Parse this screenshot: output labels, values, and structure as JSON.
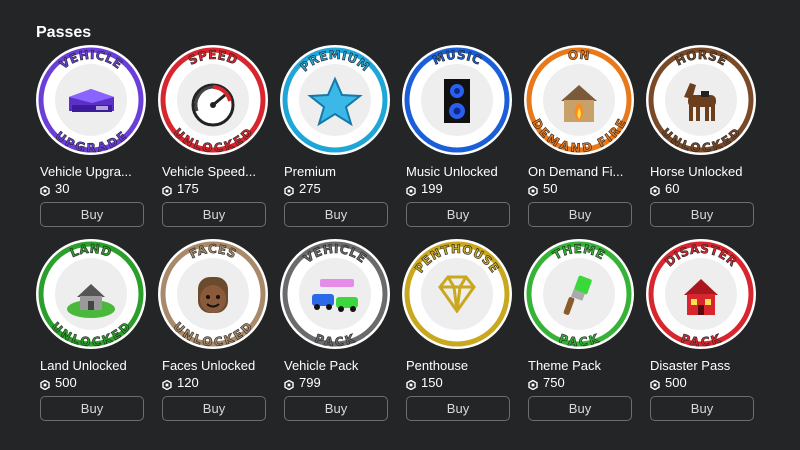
{
  "section": {
    "title": "Passes"
  },
  "passes": [
    {
      "name": "Vehicle Upgra...",
      "price": "30",
      "buy_label": "Buy",
      "ring_top": "VEHICLE",
      "ring_bottom": "UPGRADE",
      "color": "#6a3fd8",
      "icon": "vehicle-upgrade-icon"
    },
    {
      "name": "Vehicle Speed...",
      "price": "175",
      "buy_label": "Buy",
      "ring_top": "SPEED",
      "ring_bottom": "UNLOCKED",
      "color": "#d8262e",
      "icon": "speedometer-icon"
    },
    {
      "name": "Premium",
      "price": "275",
      "buy_label": "Buy",
      "ring_top": "PREMIUM",
      "ring_bottom": "",
      "color": "#1fa6d8",
      "icon": "star-icon"
    },
    {
      "name": "Music Unlocked",
      "price": "199",
      "buy_label": "Buy",
      "ring_top": "MUSIC",
      "ring_bottom": "",
      "color": "#1a5fd8",
      "icon": "speaker-icon"
    },
    {
      "name": "On Demand Fi...",
      "price": "50",
      "buy_label": "Buy",
      "ring_top": "ON",
      "ring_bottom": "DEMAND FIRE",
      "color": "#e8781a",
      "icon": "burning-house-icon"
    },
    {
      "name": "Horse Unlocked",
      "price": "60",
      "buy_label": "Buy",
      "ring_top": "HORSE",
      "ring_bottom": "UNLOCKED",
      "color": "#7a4a28",
      "icon": "horse-icon"
    },
    {
      "name": "Land Unlocked",
      "price": "500",
      "buy_label": "Buy",
      "ring_top": "LAND",
      "ring_bottom": "UNLOCKED",
      "color": "#2aa02a",
      "icon": "land-house-icon"
    },
    {
      "name": "Faces Unlocked",
      "price": "120",
      "buy_label": "Buy",
      "ring_top": "FACES",
      "ring_bottom": "UNLOCKED",
      "color": "#a88a6a",
      "icon": "face-icon"
    },
    {
      "name": "Vehicle Pack",
      "price": "799",
      "buy_label": "Buy",
      "ring_top": "VEHICLE",
      "ring_bottom": "PACK",
      "color": "#6b6b6b",
      "icon": "cars-icon"
    },
    {
      "name": "Penthouse",
      "price": "150",
      "buy_label": "Buy",
      "ring_top": "PENTHOUSE",
      "ring_bottom": "",
      "color": "#c9a820",
      "icon": "diamond-icon"
    },
    {
      "name": "Theme Pack",
      "price": "750",
      "buy_label": "Buy",
      "ring_top": "THEME",
      "ring_bottom": "PACK",
      "color": "#36b236",
      "icon": "paintbrush-icon"
    },
    {
      "name": "Disaster Pass",
      "price": "500",
      "buy_label": "Buy",
      "ring_top": "DISASTER",
      "ring_bottom": "PACK",
      "color": "#d8262e",
      "icon": "disaster-house-icon"
    }
  ]
}
